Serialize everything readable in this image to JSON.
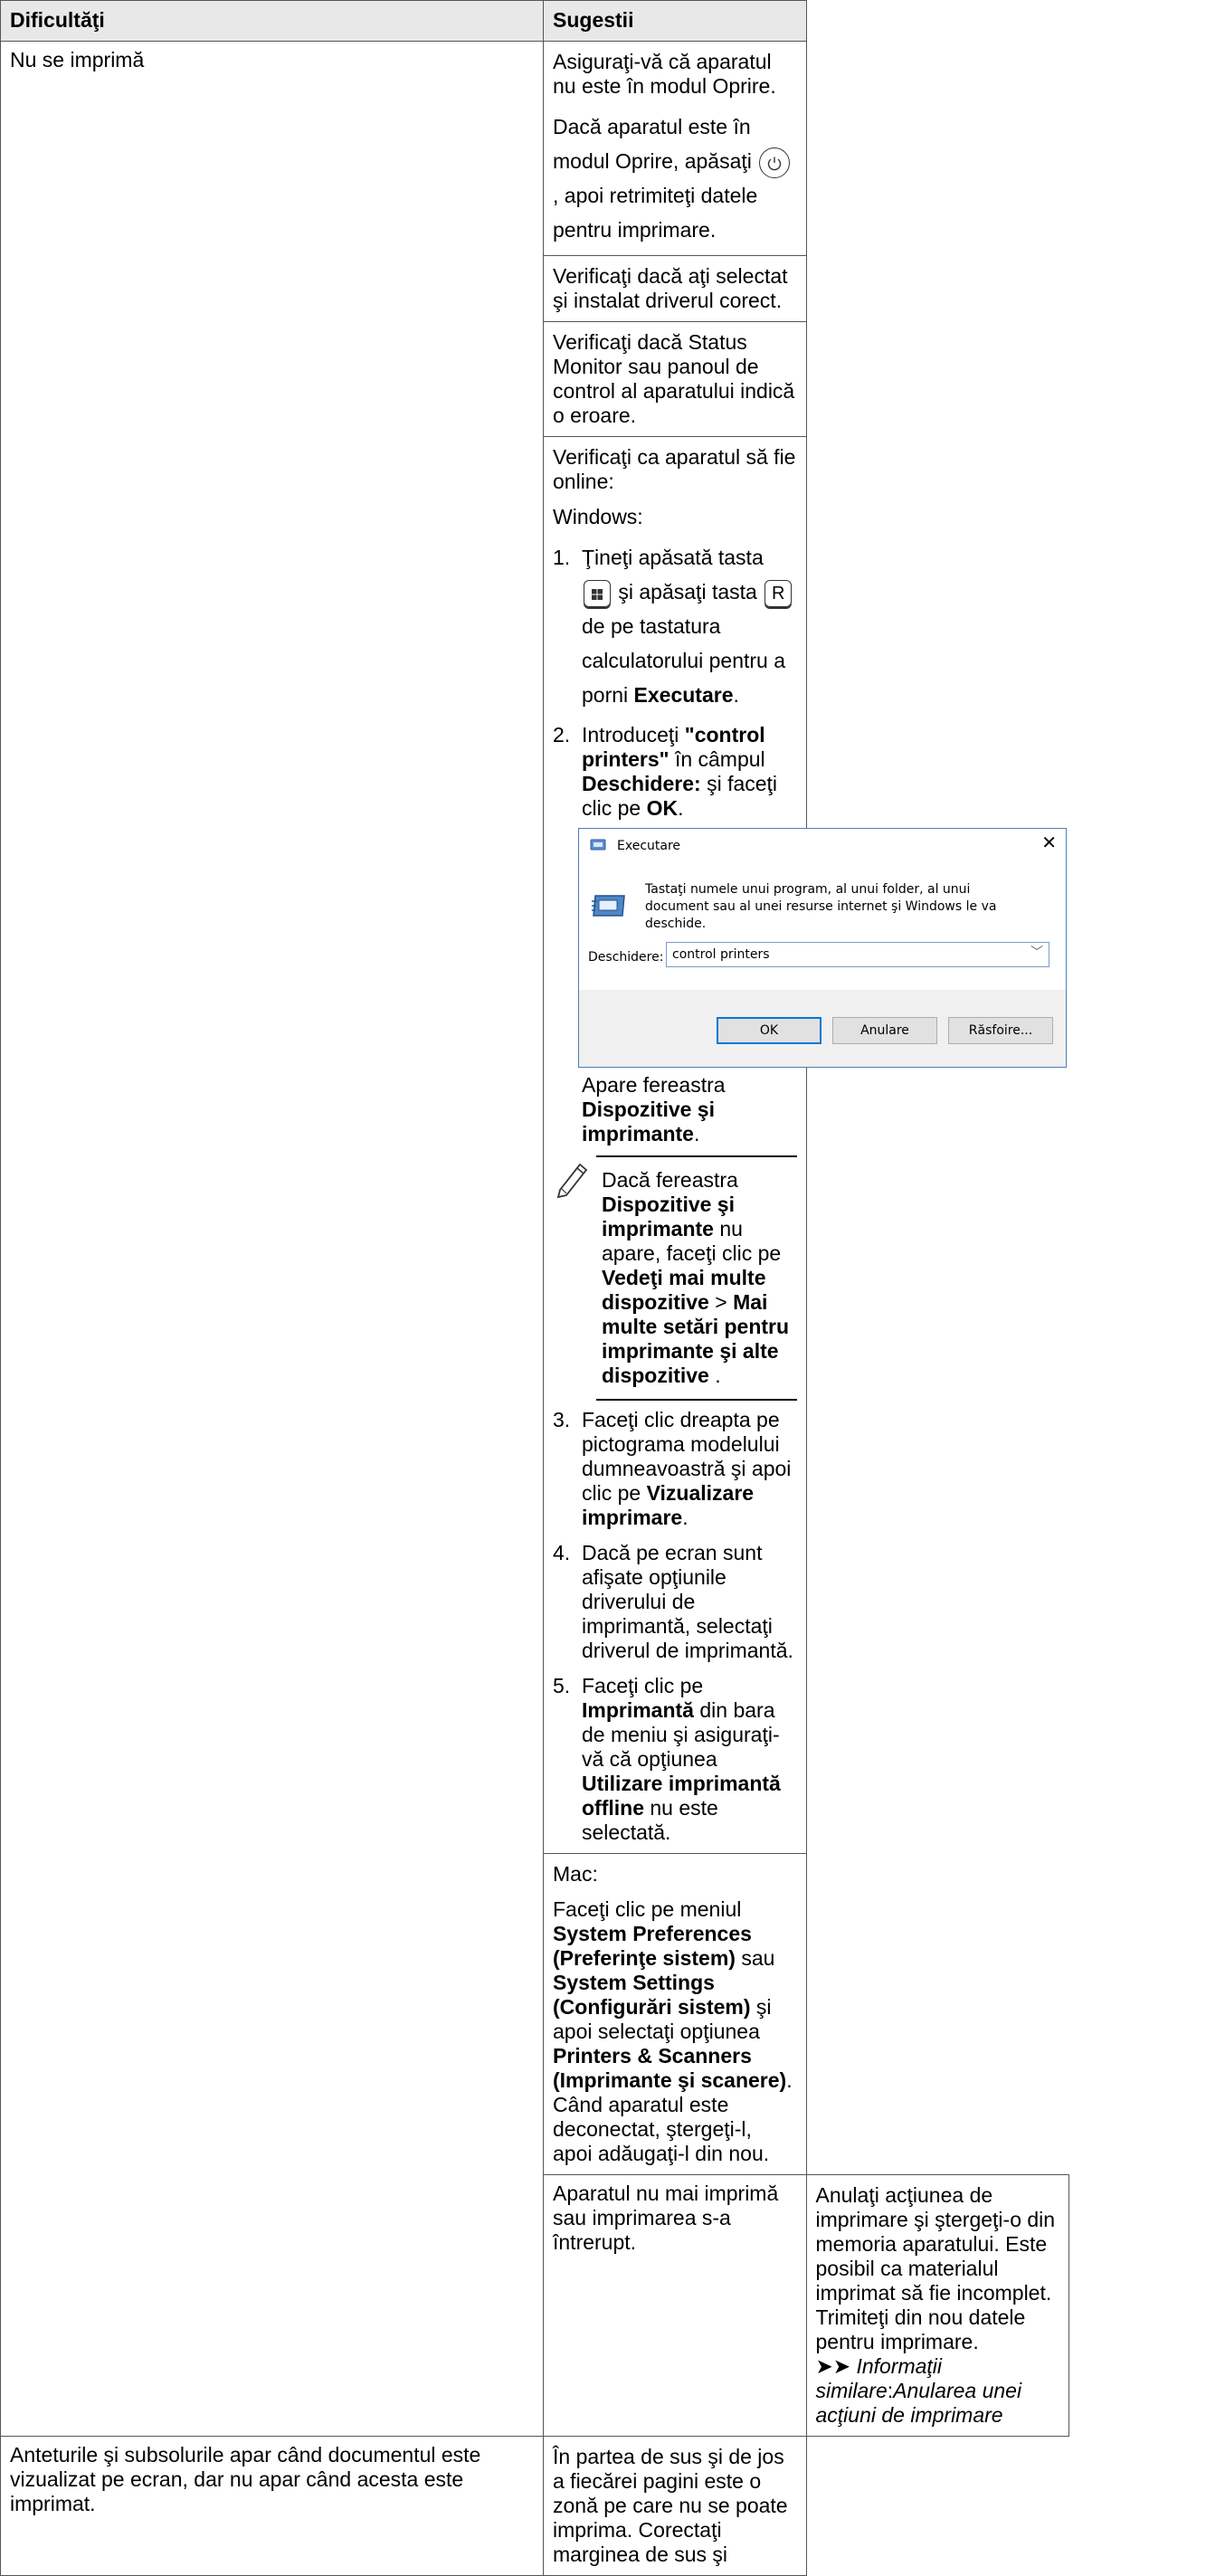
{
  "headers": {
    "col1": "Dificultăţi",
    "col2": "Sugestii"
  },
  "row1": {
    "problem": "Nu se imprimă",
    "s1": "Asiguraţi-vă că aparatul nu este în modul Oprire.",
    "s2_a": "Dacă aparatul este în modul Oprire, apăsaţi",
    "s2_b": ", apoi retrimiteţi datele pentru imprimare.",
    "s3": "Verificaţi dacă aţi selectat şi instalat driverul corect.",
    "s4": "Verificaţi dacă Status Monitor sau panoul de control al aparatului indică o eroare.",
    "s5_intro": "Verificaţi ca aparatul să fie online:",
    "s5_windows": "Windows:",
    "step1": {
      "num": "1.",
      "t1": "Ţineţi apăsată tasta",
      "t2": "şi apăsaţi tasta",
      "key_r": "R",
      "t3": "de pe tastatura calculatorului pentru a porni",
      "bold": "Executare",
      "end": "."
    },
    "step2": {
      "num": "2.",
      "t1": "Introduceţi",
      "b1": "\"control printers\"",
      "t2": "în câmpul",
      "b2": "Deschidere:",
      "t3": "şi faceţi clic pe",
      "b3": "OK",
      "end": "."
    },
    "dialog": {
      "title": "Executare",
      "message": "Tastaţi numele unui program, al unui folder, al unui document sau al unei resurse internet şi Windows le va deschide.",
      "label": "Deschidere:",
      "value": "control printers",
      "ok": "OK",
      "cancel": "Anulare",
      "browse": "Răsfoire..."
    },
    "appears": {
      "t1": "Apare fereastra",
      "b1": "Dispozitive şi imprimante",
      "end": "."
    },
    "note": {
      "t1": "Dacă fereastra",
      "b1": "Dispozitive şi imprimante",
      "t2": "nu apare, faceţi clic pe",
      "b2": "Vedeţi mai multe dispozitive",
      "t3": ">",
      "b3": "Mai multe setări pentru imprimante şi alte dispozitive",
      "end": "."
    },
    "step3": {
      "num": "3.",
      "t1": "Faceţi clic dreapta pe pictograma modelului dumneavoastră şi apoi clic pe",
      "b1": "Vizualizare imprimare",
      "end": "."
    },
    "step4": {
      "num": "4.",
      "t1": "Dacă pe ecran sunt afişate opţiunile driverului de imprimantă, selectaţi driverul de imprimantă."
    },
    "step5": {
      "num": "5.",
      "t1": "Faceţi clic pe",
      "b1": "Imprimantă",
      "t2": "din bara de meniu şi asiguraţi-vă că opţiunea",
      "b2": "Utilizare imprimantă offline",
      "t3": "nu este selectată."
    },
    "mac": {
      "label": "Mac:",
      "t1": "Faceţi clic pe meniul",
      "b1": "System Preferences (Preferinţe sistem)",
      "t2": "sau",
      "b2": "System Settings (Configurări sistem)",
      "t3": "şi apoi selectaţi opţiunea",
      "b3": "Printers & Scanners (Imprimante şi scanere)",
      "t4": ". Când aparatul este deconectat, ştergeţi-l, apoi adăugaţi-l din nou."
    }
  },
  "row2": {
    "problem": "Aparatul nu mai imprimă sau imprimarea s-a întrerupt.",
    "text": "Anulaţi acţiunea de imprimare şi ştergeţi-o din memoria aparatului. Este posibil ca materialul imprimat să fie incomplet. Trimiteţi din nou datele pentru imprimare.",
    "arrows": "➤➤",
    "related_label": "Informaţii similare",
    "related_sep": ":",
    "related_link": "Anularea unei acţiuni de imprimare"
  },
  "row3": {
    "problem": "Anteturile şi subsolurile apar când documentul este vizualizat pe ecran, dar nu apar când acesta este imprimat.",
    "text": "În partea de sus şi de jos a fiecărei pagini este o zonă pe care nu se poate imprima. Corectaţi marginea de sus şi"
  },
  "icons": {
    "power": "power-icon",
    "windows": "windows-key-icon",
    "run": "run-dialog-icon",
    "close": "close-icon",
    "dropdown": "chevron-down-icon",
    "note": "pencil-note-icon"
  }
}
